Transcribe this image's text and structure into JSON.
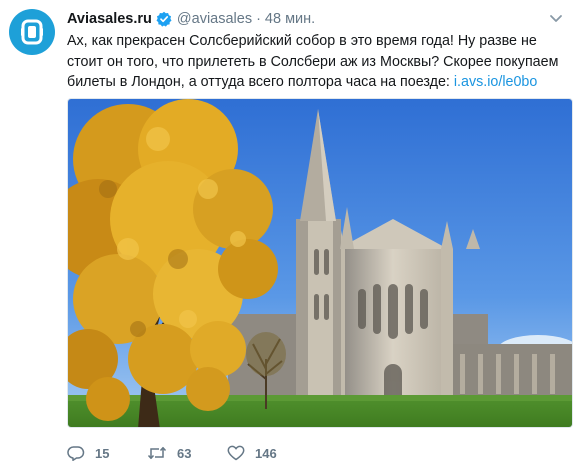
{
  "tweet": {
    "author_name": "Aviasales.ru",
    "handle": "@aviasales",
    "separator": "·",
    "time": "48 мин.",
    "text_before_link": "Ах, как прекрасен Солсберийский собор в это время года! Ну разве не стоит он того, что прилететь в Солсбери аж из Москвы? Скорее покупаем билеты в Лондон, а оттуда всего полтора часа на поезде: ",
    "link_text": "i.avs.io/le0bo",
    "verified": true,
    "photo_subject": "salisbury-cathedral-autumn-photo"
  },
  "actions": {
    "reply_count": "15",
    "retweet_count": "63",
    "like_count": "146"
  },
  "icons": {
    "avatar": "aviasales-logo-icon",
    "verified": "verified-badge-icon",
    "caret": "chevron-down-icon",
    "reply": "reply-icon",
    "retweet": "retweet-icon",
    "like": "heart-icon"
  },
  "colors": {
    "accent": "#1da1f2",
    "link": "#1b95e0",
    "muted": "#657786",
    "avatar_bg": "#1ea0d8"
  }
}
